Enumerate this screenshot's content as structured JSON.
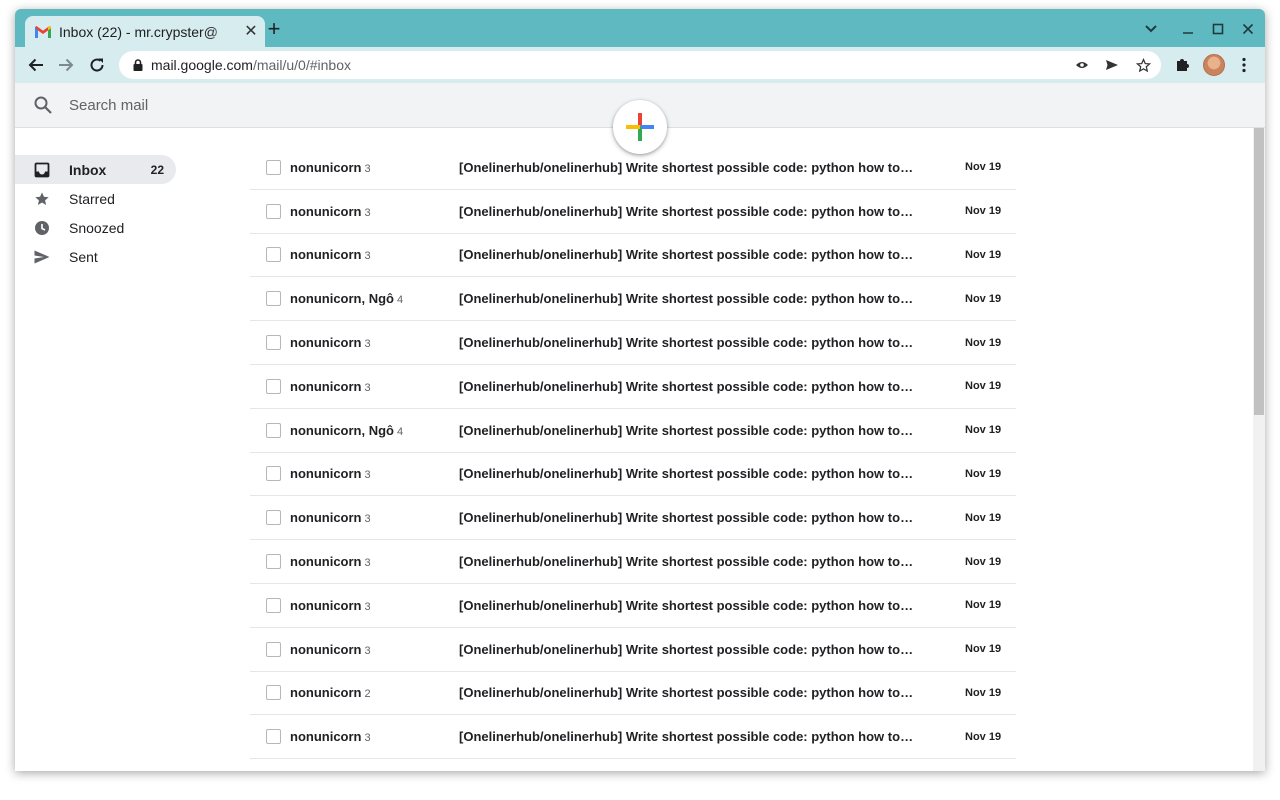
{
  "browser": {
    "tab_title": "Inbox (22) - mr.crypster@",
    "tab_close": "✕",
    "new_tab": "+",
    "url_host": "mail.google.com",
    "url_path": "/mail/u/0/#inbox"
  },
  "gmail": {
    "search_placeholder": "Search mail"
  },
  "sidebar": {
    "items": [
      {
        "label": "Inbox",
        "count": "22",
        "icon": "inbox-icon"
      },
      {
        "label": "Starred",
        "count": "",
        "icon": "star-icon"
      },
      {
        "label": "Snoozed",
        "count": "",
        "icon": "clock-icon"
      },
      {
        "label": "Sent",
        "count": "",
        "icon": "send-icon"
      }
    ]
  },
  "emails": [
    {
      "sender": "nonunicorn",
      "count": "3",
      "subject": "[Onelinerhub/onelinerhub] Write shortest possible code: python how to …",
      "date": "Nov 19"
    },
    {
      "sender": "nonunicorn",
      "count": "3",
      "subject": "[Onelinerhub/onelinerhub] Write shortest possible code: python how to r…",
      "date": "Nov 19"
    },
    {
      "sender": "nonunicorn",
      "count": "3",
      "subject": "[Onelinerhub/onelinerhub] Write shortest possible code: python how to …",
      "date": "Nov 19"
    },
    {
      "sender": "nonunicorn, Ngô",
      "count": "4",
      "subject": "[Onelinerhub/onelinerhub] Write shortest possible code: python how to …",
      "date": "Nov 19"
    },
    {
      "sender": "nonunicorn",
      "count": "3",
      "subject": "[Onelinerhub/onelinerhub] Write shortest possible code: python how to r…",
      "date": "Nov 19"
    },
    {
      "sender": "nonunicorn",
      "count": "3",
      "subject": "[Onelinerhub/onelinerhub] Write shortest possible code: python how to r…",
      "date": "Nov 19"
    },
    {
      "sender": "nonunicorn, Ngô",
      "count": "4",
      "subject": "[Onelinerhub/onelinerhub] Write shortest possible code: python how to r…",
      "date": "Nov 19"
    },
    {
      "sender": "nonunicorn",
      "count": "3",
      "subject": "[Onelinerhub/onelinerhub] Write shortest possible code: python how to …",
      "date": "Nov 19"
    },
    {
      "sender": "nonunicorn",
      "count": "3",
      "subject": "[Onelinerhub/onelinerhub] Write shortest possible code: python how to t…",
      "date": "Nov 19"
    },
    {
      "sender": "nonunicorn",
      "count": "3",
      "subject": "[Onelinerhub/onelinerhub] Write shortest possible code: python how to …",
      "date": "Nov 19"
    },
    {
      "sender": "nonunicorn",
      "count": "3",
      "subject": "[Onelinerhub/onelinerhub] Write shortest possible code: python how to t…",
      "date": "Nov 19"
    },
    {
      "sender": "nonunicorn",
      "count": "3",
      "subject": "[Onelinerhub/onelinerhub] Write shortest possible code: python how to …",
      "date": "Nov 19"
    },
    {
      "sender": "nonunicorn",
      "count": "2",
      "subject": "[Onelinerhub/onelinerhub] Write shortest possible code: python how to …",
      "date": "Nov 19"
    },
    {
      "sender": "nonunicorn",
      "count": "3",
      "subject": "[Onelinerhub/onelinerhub] Write shortest possible code: python how to …",
      "date": "Nov 19"
    }
  ]
}
